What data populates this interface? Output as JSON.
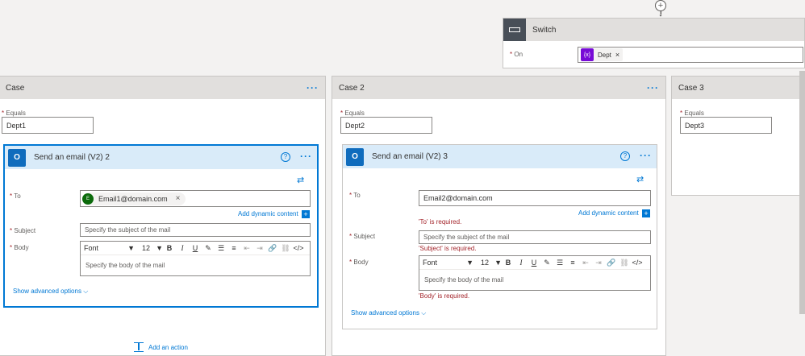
{
  "switch": {
    "title": "Switch",
    "on_label": "On",
    "on_token": "Dept",
    "token_icon": "{x}"
  },
  "cases": [
    {
      "title": "Case",
      "equals_label": "Equals",
      "equals_value": "Dept1",
      "action": {
        "title": "Send an email (V2) 2",
        "to_label": "To",
        "to_token": "Email1@domain.com",
        "to_avatar": "E",
        "add_dynamic": "Add dynamic content",
        "subject_label": "Subject",
        "subject_placeholder": "Specify the subject of the mail",
        "body_label": "Body",
        "font_label": "Font",
        "font_size": "12",
        "body_placeholder": "Specify the body of the mail",
        "advanced": "Show advanced options"
      },
      "add_action": "Add an action"
    },
    {
      "title": "Case 2",
      "equals_label": "Equals",
      "equals_value": "Dept2",
      "action": {
        "title": "Send an email (V2) 3",
        "to_label": "To",
        "to_value": "Email2@domain.com",
        "add_dynamic": "Add dynamic content",
        "to_error": "'To' is required.",
        "subject_label": "Subject",
        "subject_placeholder": "Specify the subject of the mail",
        "subject_error": "'Subject' is required.",
        "body_label": "Body",
        "font_label": "Font",
        "font_size": "12",
        "body_placeholder": "Specify the body of the mail",
        "body_error": "'Body' is required.",
        "advanced": "Show advanced options"
      }
    },
    {
      "title": "Case 3",
      "equals_label": "Equals",
      "equals_value": "Dept3"
    }
  ],
  "colors": {
    "accent": "#0078d4",
    "error": "#a4262c",
    "header_gray": "#e1dfdd",
    "action_header": "#d9ebf9",
    "token_purple": "#770bd6"
  }
}
